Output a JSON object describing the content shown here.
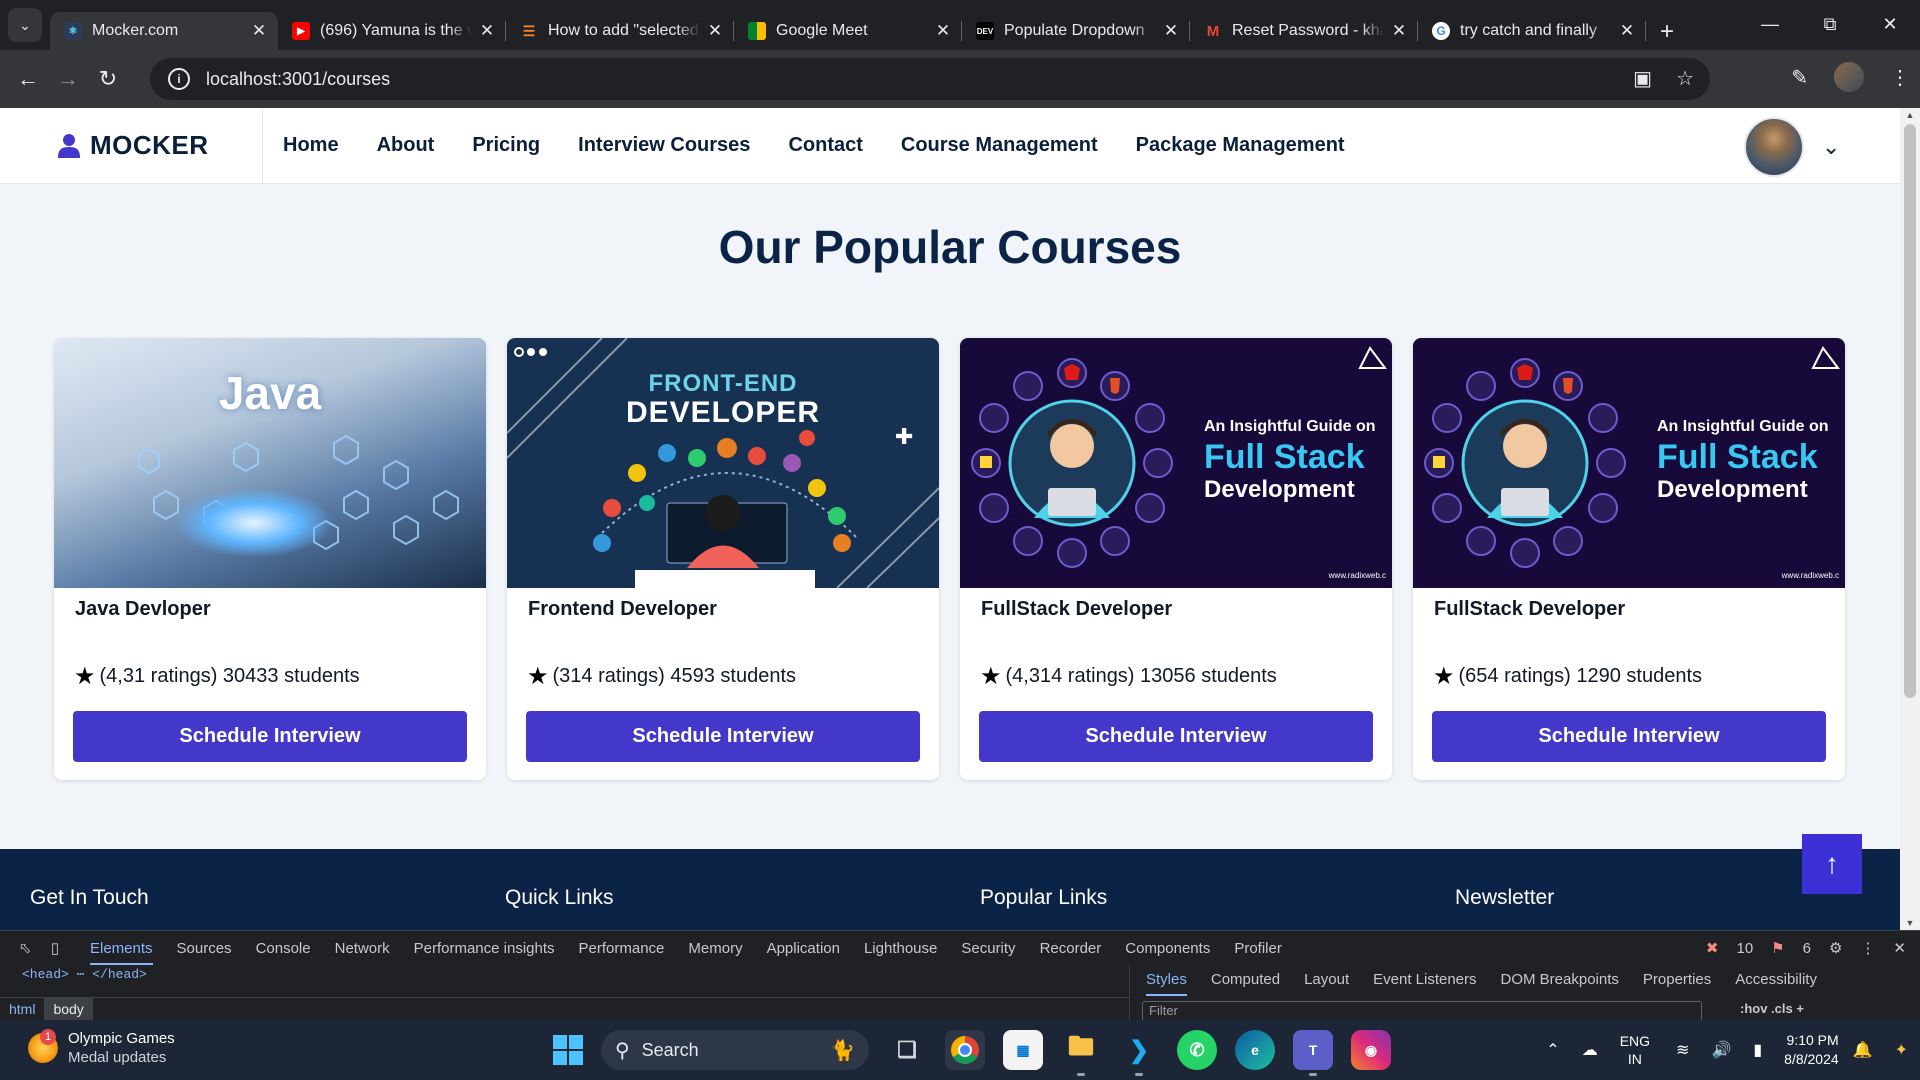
{
  "browser": {
    "tabs": [
      {
        "title": "Mocker.com",
        "favicon": "react-icon",
        "fav_color": "#2d3b55",
        "active": true
      },
      {
        "title": "(696) Yamuna is the v",
        "favicon": "youtube-icon",
        "fav_color": "#ff0000",
        "active": false
      },
      {
        "title": "How to add \"selected",
        "favicon": "stackoverflow-icon",
        "fav_color": "#f48024",
        "active": false
      },
      {
        "title": "Google Meet",
        "favicon": "meet-icon",
        "fav_color": "#00832d",
        "active": false
      },
      {
        "title": "Populate Dropdown",
        "favicon": "dev-icon",
        "fav_color": "#000000",
        "active": false
      },
      {
        "title": "Reset Password - kha",
        "favicon": "gmail-icon",
        "fav_color": "#ea4335",
        "active": false
      },
      {
        "title": "try catch and finally",
        "favicon": "google-icon",
        "fav_color": "#4285f4",
        "active": false
      }
    ],
    "url": "localhost:3001/courses"
  },
  "site": {
    "brand": "MOCKER",
    "nav": [
      {
        "label": "Home"
      },
      {
        "label": "About"
      },
      {
        "label": "Pricing"
      },
      {
        "label": "Interview Courses"
      },
      {
        "label": "Contact"
      },
      {
        "label": "Course Management"
      },
      {
        "label": "Package Management"
      }
    ],
    "heading": "Our Popular Courses",
    "courses": [
      {
        "title": "Java Devloper",
        "meta": "(4,31 ratings) 30433 students",
        "button": "Schedule Interview",
        "thumb_text": "Java"
      },
      {
        "title": "Frontend Developer",
        "meta": "(314 ratings) 4593 students",
        "button": "Schedule Interview",
        "thumb_text_1": "FRONT-END",
        "thumb_text_2": "DEVELOPER"
      },
      {
        "title": "FullStack Developer",
        "meta": "(4,314 ratings) 13056 students",
        "button": "Schedule Interview",
        "thumb_line1": "An Insightful Guide on",
        "thumb_line2": "Full Stack",
        "thumb_line3": "Development",
        "thumb_web": "www.radixweb.c"
      },
      {
        "title": "FullStack Developer",
        "meta": "(654 ratings) 1290 students",
        "button": "Schedule Interview",
        "thumb_line1": "An Insightful Guide on",
        "thumb_line2": "Full Stack",
        "thumb_line3": "Development",
        "thumb_web": "www.radixweb.c"
      }
    ],
    "footer": [
      "Get In Touch",
      "Quick Links",
      "Popular Links",
      "Newsletter"
    ],
    "accent": "#4338ca",
    "dark": "#0b2346"
  },
  "devtools": {
    "tabs": [
      "Elements",
      "Sources",
      "Console",
      "Network",
      "Performance insights",
      "Performance",
      "Memory",
      "Application",
      "Lighthouse",
      "Security",
      "Recorder",
      "Components",
      "Profiler"
    ],
    "errors": "10",
    "warnings": "6",
    "code_line": "<head> ⋯ </head>",
    "crumbs": [
      "html",
      "body"
    ],
    "side_tabs": [
      "Styles",
      "Computed",
      "Layout",
      "Event Listeners",
      "DOM Breakpoints",
      "Properties",
      "Accessibility"
    ],
    "filter_placeholder": "Filter",
    "side_tools": ":hov  .cls  +"
  },
  "taskbar": {
    "widget_title": "Olympic Games",
    "widget_sub": "Medal updates",
    "widget_badge": "1",
    "search": "Search",
    "lang1": "ENG",
    "lang2": "IN",
    "time": "9:10 PM",
    "date": "8/8/2024"
  }
}
